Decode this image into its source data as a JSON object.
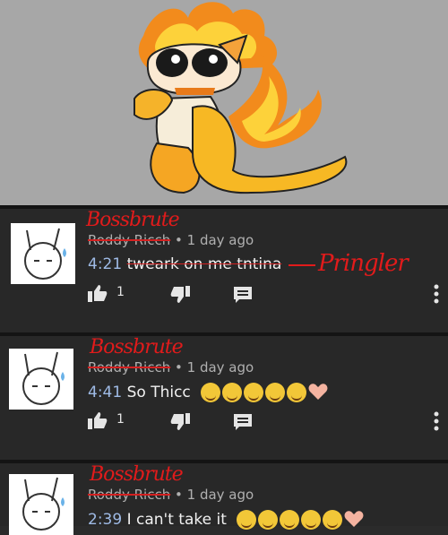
{
  "comments": [
    {
      "handwritten_name": "Bossbrute",
      "author": "Roddy Ricch",
      "separator": "•",
      "age": "1 day ago",
      "timestamp": "4:21",
      "text": "tweark on me tntina",
      "like_count": "1",
      "annotation": "Pringler",
      "emoji_count": 0
    },
    {
      "handwritten_name": "Bossbrute",
      "author": "Roddy Ricch",
      "separator": "•",
      "age": "1 day ago",
      "timestamp": "4:41",
      "text": "So Thicc",
      "like_count": "1",
      "emoji_count": 5
    },
    {
      "handwritten_name": "Bossbrute",
      "author": "Roddy Ricch",
      "separator": "•",
      "age": "1 day ago",
      "timestamp": "2:39",
      "text": "I can't take it",
      "emoji_count": 5
    }
  ],
  "colors": {
    "timestamp": "#9fbbe6",
    "annotation_red": "#e11b1b",
    "background": "#282828"
  },
  "icons": [
    "thumbs-up-icon",
    "thumbs-down-icon",
    "reply-icon",
    "more-vert-icon",
    "laughing-emoji-icon",
    "heart-emoji-icon"
  ]
}
